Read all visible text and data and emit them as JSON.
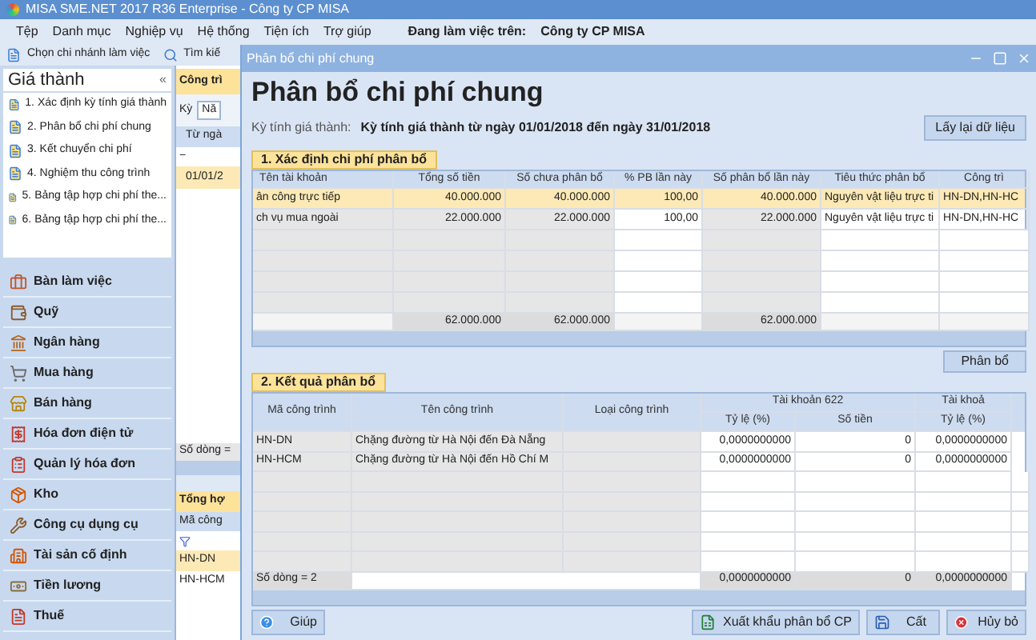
{
  "app_title": "MISA SME.NET 2017 R36 Enterprise - Công ty CP MISA",
  "menu": [
    "Tệp",
    "Danh mục",
    "Nghiệp vụ",
    "Hệ thống",
    "Tiện ích",
    "Trợ giúp"
  ],
  "workspace": {
    "label": "Đang làm việc trên:",
    "value": "Công ty CP MISA"
  },
  "toolbar": [
    "Chọn chi nhánh làm việc",
    "Tìm kiế"
  ],
  "sidebar": {
    "title": "Giá thành",
    "collapse": "«",
    "steps": [
      "1. Xác định kỳ tính giá thành",
      "2. Phân bổ chi phí chung",
      "3. Kết chuyển chi phí",
      "4. Nghiệm thu công trình",
      "5. Bảng tập hợp chi phí the...",
      "6. Bảng tập hợp chi phí the..."
    ],
    "modules": [
      "Bàn làm việc",
      "Quỹ",
      "Ngân hàng",
      "Mua hàng",
      "Bán hàng",
      "Hóa đơn điện tử",
      "Quản lý hóa đơn",
      "Kho",
      "Công cụ dụng cụ",
      "Tài sản cố định",
      "Tiền lương",
      "Thuế"
    ]
  },
  "background_panel": {
    "tab": "Công trì",
    "period_label": "Kỳ",
    "period_value": "Nă",
    "column": "Từ ngà",
    "collapse": "−",
    "rows": [
      {
        "text": "01/01/2",
        "selected": true
      }
    ],
    "row_count": "Số dòng =",
    "summary_tab": "Tổng hợ",
    "summary_column": "Mã công",
    "summary_rows": [
      {
        "text": "HN-DN",
        "selected": true
      },
      {
        "text": "HN-HCM",
        "selected": false
      }
    ]
  },
  "dialog": {
    "title": "Phân bổ chi phí chung",
    "heading": "Phân bổ chi phí chung",
    "period_label": "Kỳ tính giá thành:",
    "period_value": "Kỳ tính giá thành từ ngày 01/01/2018 đến ngày 31/01/2018",
    "reload_button": "Lấy lại dữ liệu",
    "section1": {
      "tab": "1. Xác định chi phí phân bổ",
      "columns": [
        "Tên tài khoản",
        "Tổng số tiền",
        "Số chưa phân bổ",
        "% PB lần này",
        "Số phân bổ lần này",
        "Tiêu thức phân bổ",
        "Công trì"
      ],
      "rows": [
        {
          "cells": [
            "ân công trực tiếp",
            "40.000.000",
            "40.000.000",
            "100,00",
            "40.000.000",
            "Nguyên vật liệu trực ti",
            "HN-DN,HN-HC"
          ],
          "selected": true
        },
        {
          "cells": [
            "ch vụ mua ngoài",
            "22.000.000",
            "22.000.000",
            "100,00",
            "22.000.000",
            "Nguyên vật liệu trực ti",
            "HN-DN,HN-HC"
          ],
          "selected": false
        }
      ],
      "totals": {
        "total_amount": "62.000.000",
        "unallocated": "62.000.000",
        "allocated": "62.000.000"
      }
    },
    "allocate_button": "Phân bổ",
    "section2": {
      "tab": "2. Kết quả phân bổ",
      "columns": [
        "Mã công trình",
        "Tên công trình",
        "Loại công trình"
      ],
      "groups": [
        {
          "title": "Tài khoản 622",
          "columns": [
            "Tỷ lệ (%)",
            "Số tiền"
          ]
        },
        {
          "title": "Tài khoả",
          "columns": [
            "Tỷ lệ (%)"
          ]
        }
      ],
      "rows": [
        {
          "code": "HN-DN",
          "name": "Chặng đường từ Hà Nội đến Đà Nẵng",
          "rate_622": "0,0000000000",
          "amount_622": "0",
          "rate_next": "0,0000000000"
        },
        {
          "code": "HN-HCM",
          "name": "Chặng đường từ Hà Nội đến Hồ Chí M",
          "rate_622": "0,0000000000",
          "amount_622": "0",
          "rate_next": "0,0000000000"
        }
      ],
      "row_count": "Số dòng = 2",
      "totals": [
        "0,0000000000",
        "0",
        "0,0000000000"
      ]
    },
    "buttons": {
      "help": "Giúp",
      "export": "Xuất khẩu phân bổ CP",
      "save": "Cất",
      "cancel": "Hủy bỏ"
    }
  }
}
